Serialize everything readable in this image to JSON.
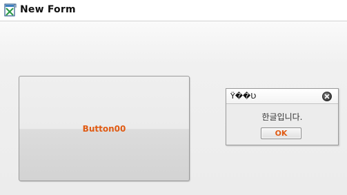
{
  "window": {
    "title": "New Form",
    "app_icon": "form-app-icon"
  },
  "main": {
    "button_label": "Button00"
  },
  "message_box": {
    "title": "Ÿ��Ʋ",
    "message": "한글입니다.",
    "ok_label": "OK",
    "close_icon": "close-icon"
  },
  "colors": {
    "button_text": "#e05a12",
    "background": "#f1f1f1"
  }
}
